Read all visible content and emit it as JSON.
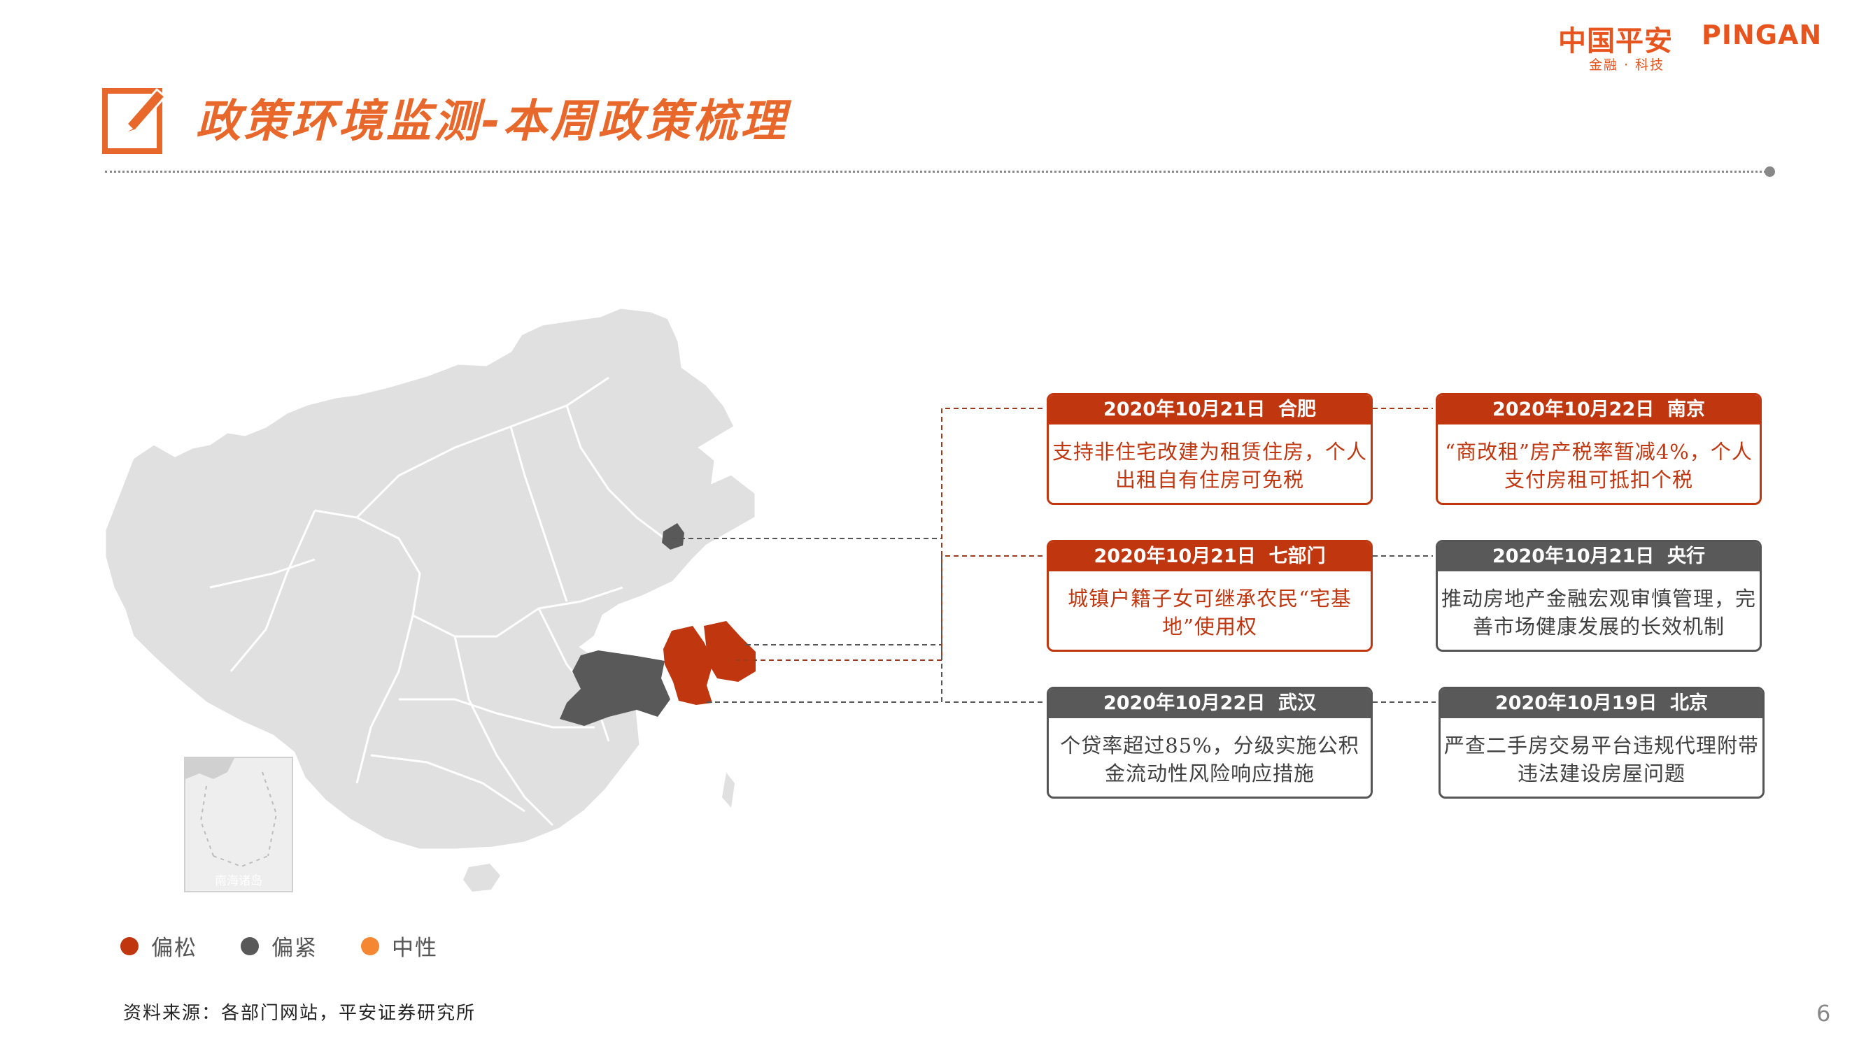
{
  "header": {
    "title": "政策环境监测-本周政策梳理",
    "logo_cn": "中国平安",
    "logo_en": "PINGAN",
    "logo_sub": "金融 · 科技"
  },
  "map": {
    "inset_label": "南海诸岛"
  },
  "cards": [
    {
      "date": "2020年10月21日",
      "place": "合肥",
      "text": "支持非住宅改建为租赁住房，个人出租自有住房可免税",
      "stance": "偏松"
    },
    {
      "date": "2020年10月22日",
      "place": "南京",
      "text": "“商改租”房产税率暂减4%，个人支付房租可抵扣个税",
      "stance": "偏松"
    },
    {
      "date": "2020年10月21日",
      "place": "七部门",
      "text": "城镇户籍子女可继承农民“宅基地”使用权",
      "stance": "偏松"
    },
    {
      "date": "2020年10月21日",
      "place": "央行",
      "text": "推动房地产金融宏观审慎管理，完善市场健康发展的长效机制",
      "stance": "偏紧"
    },
    {
      "date": "2020年10月22日",
      "place": "武汉",
      "text": "个贷率超过85%，分级实施公积金流动性风险响应措施",
      "stance": "偏紧"
    },
    {
      "date": "2020年10月19日",
      "place": "北京",
      "text": "严查二手房交易平台违规代理附带违法建设房屋问题",
      "stance": "偏紧"
    }
  ],
  "legend": [
    {
      "label": "偏松",
      "color": "#c0360f"
    },
    {
      "label": "偏紧",
      "color": "#595959"
    },
    {
      "label": "中性",
      "color": "#f58733"
    }
  ],
  "colors": {
    "accent": "#e8672a",
    "loose": "#c0360f",
    "tight": "#595959",
    "map_fill": "#e0e0e0"
  },
  "footer": {
    "source": "资料来源：各部门网站，平安证券研究所",
    "page": "6"
  }
}
